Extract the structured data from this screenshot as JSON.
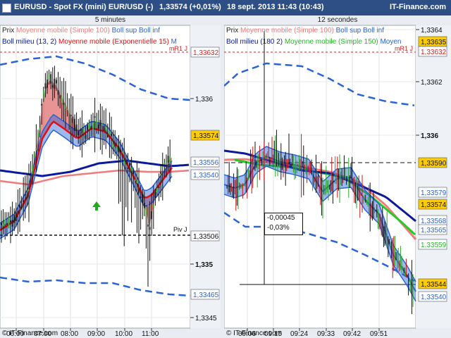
{
  "header": {
    "symbol": "EURUSD - Spot FX (mini) EUR/USD (-)",
    "quote": "1,33574 (+0,01%)",
    "datetime": "18 sept. 2013 11:43 (10:43)",
    "brand": "IT-Finance.com"
  },
  "left": {
    "title": "5 minutes",
    "legend1": {
      "prix": "Prix",
      "ma": "Moyenne mobile (Simple 100)",
      "boll": "Boll sup Boll inf"
    },
    "legend2": {
      "boll": "Boll milieu (13, 2)",
      "ma": "Moyenne mobile (Exponentielle 15)",
      "tail": "M"
    },
    "mr1": "mR1 J",
    "piv": "Piv J",
    "yticks": [
      "1,336",
      "1,335",
      "1,3345"
    ],
    "price_tags": [
      "1,33632",
      "1,33574",
      "1,33556",
      "1,33540",
      "1,33506",
      "1,33465"
    ],
    "xticks": [
      "06:00",
      "07:00",
      "08:00",
      "09:00",
      "10:00",
      "11:00"
    ],
    "copyright": "© IT-Finance.com"
  },
  "right": {
    "title": "12 secondes",
    "legend1": {
      "prix": "Prix",
      "ma": "Moyenne mobile (Simple 100)",
      "boll": "Boll sup Boll inf"
    },
    "legend2": {
      "boll": "Boll milieu (180 2)",
      "ma": "Moyenne mobile (Simple 150)",
      "tail": "Moyen"
    },
    "mr1": "mR1 J",
    "yticks": [
      "1,3364",
      "1,3362",
      "1,336"
    ],
    "price_tags": [
      "1,33635",
      "1,33632",
      "1,33590",
      "1,33579",
      "1,33574",
      "1,33568",
      "1,33565",
      "1,33559",
      "1,33544",
      "1,33540"
    ],
    "measure": [
      "-0,00045",
      "-0,03%"
    ],
    "xticks": [
      "09:06",
      "09:15",
      "09:24",
      "09:33",
      "09:42",
      "09:51"
    ],
    "copyright": "© IT-Finance.com"
  },
  "colors": {
    "title_bg": "#2d4f86",
    "bull": "#22aa22",
    "bear": "#cc1111",
    "candle": "#111111",
    "ma_simple100": "#f07c7c",
    "ema15": "#e01010",
    "boll": "#2a63d8",
    "boll_mid": "#0a1a9a",
    "sma150": "#22cc22",
    "tag_yellow": "#ffcc00",
    "tag_blue": "#2a63d8",
    "tag_red": "#dd2222",
    "tag_green": "#22bb22"
  }
}
